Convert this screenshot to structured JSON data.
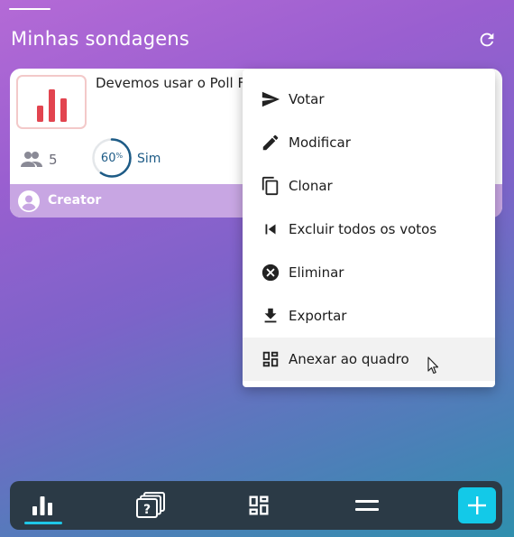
{
  "header": {
    "title": "Minhas sondagens",
    "refresh_icon": "refresh-icon"
  },
  "poll": {
    "question": "Devemos usar o Poll Fo",
    "voter_count": "5",
    "percent": "60",
    "percent_sign": "%",
    "percent_value": 0.6,
    "top_answer": "Sim",
    "creator": "Creator",
    "thumb_color": "#e2444f"
  },
  "menu": {
    "items": [
      {
        "label": "Votar",
        "icon": "send-icon"
      },
      {
        "label": "Modificar",
        "icon": "pencil-icon"
      },
      {
        "label": "Clonar",
        "icon": "copy-icon"
      },
      {
        "label": "Excluir todos os votos",
        "icon": "skip-previous-icon"
      },
      {
        "label": "Eliminar",
        "icon": "cancel-circle-icon"
      },
      {
        "label": "Exportar",
        "icon": "download-icon"
      },
      {
        "label": "Anexar ao quadro",
        "icon": "dashboard-icon"
      }
    ]
  },
  "nav": {
    "items": [
      "polls-chart-icon",
      "quizzes-icon",
      "boards-icon",
      "menu-icon"
    ],
    "fab_icon": "add-icon",
    "accent": "#1fc7e6"
  }
}
